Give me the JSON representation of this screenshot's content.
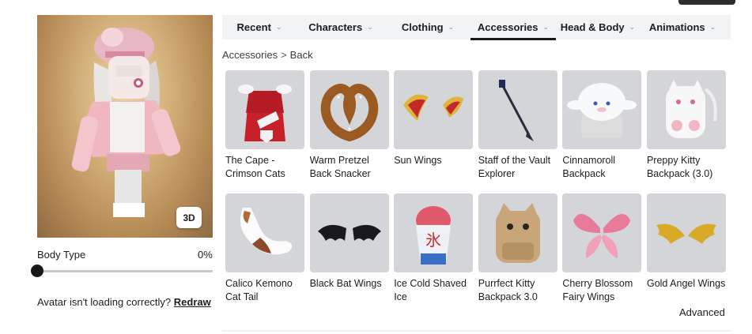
{
  "avatar": {
    "view_toggle_label": "3D",
    "body_type_label": "Body Type",
    "body_type_value": "0%",
    "body_type_fraction": 0.0,
    "loading_prompt": "Avatar isn't loading correctly?",
    "redraw_label": "Redraw"
  },
  "tabs": [
    {
      "label": "Recent",
      "active": false
    },
    {
      "label": "Characters",
      "active": false
    },
    {
      "label": "Clothing",
      "active": false
    },
    {
      "label": "Accessories",
      "active": true
    },
    {
      "label": "Head & Body",
      "active": false
    },
    {
      "label": "Animations",
      "active": false
    }
  ],
  "breadcrumb": {
    "current": "Accessories",
    "separator": ">",
    "back": "Back"
  },
  "items": [
    {
      "name": "The Cape - Crimson Cats",
      "icon": "cape-icon"
    },
    {
      "name": "Warm Pretzel Back Snacker",
      "icon": "pretzel-icon"
    },
    {
      "name": "Sun Wings",
      "icon": "sun-wings-icon"
    },
    {
      "name": "Staff of the Vault Explorer",
      "icon": "staff-icon"
    },
    {
      "name": "Cinnamoroll Backpack",
      "icon": "cinnamoroll-backpack-icon"
    },
    {
      "name": "Preppy Kitty Backpack (3.0)",
      "icon": "kitty-backpack-icon"
    },
    {
      "name": "Calico Kemono Cat Tail",
      "icon": "cat-tail-icon"
    },
    {
      "name": "Black Bat Wings",
      "icon": "bat-wings-icon"
    },
    {
      "name": "Ice Cold Shaved Ice",
      "icon": "shaved-ice-icon"
    },
    {
      "name": "Purrfect Kitty Backpack 3.0",
      "icon": "purrfect-backpack-icon"
    },
    {
      "name": "Cherry Blossom Fairy Wings",
      "icon": "fairy-wings-icon"
    },
    {
      "name": "Gold Angel Wings",
      "icon": "gold-wings-icon"
    }
  ],
  "advanced_label": "Advanced",
  "colors": {
    "tab_bar": "#f2f3f5",
    "thumb_bg": "#d4d5d8",
    "accent": "#16181a"
  }
}
